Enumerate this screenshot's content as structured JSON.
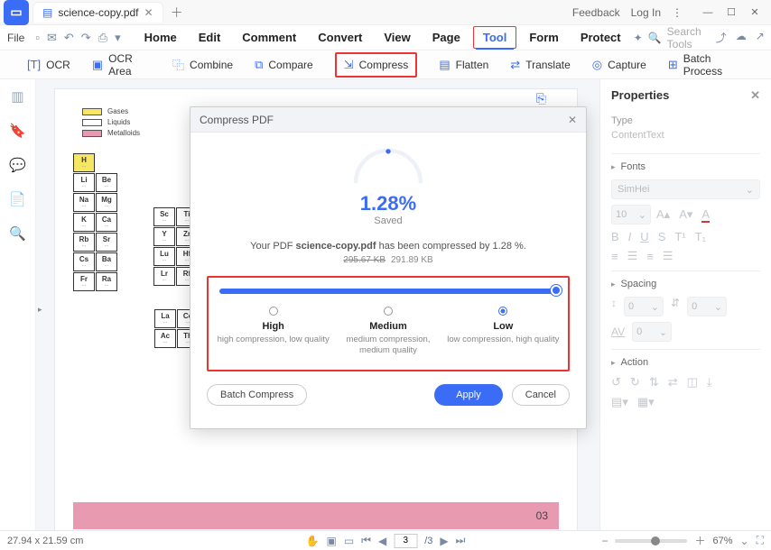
{
  "titlebar": {
    "filename": "science-copy.pdf",
    "feedback": "Feedback",
    "login": "Log In"
  },
  "menubar": {
    "file": "File",
    "items": [
      "Home",
      "Edit",
      "Comment",
      "Convert",
      "View",
      "Page",
      "Tool",
      "Form",
      "Protect"
    ],
    "active_index": 6,
    "search_placeholder": "Search Tools"
  },
  "ribbon": {
    "items": [
      "OCR",
      "OCR Area",
      "Combine",
      "Compare",
      "Compress",
      "Flatten",
      "Translate",
      "Capture",
      "Batch Process"
    ],
    "highlight_index": 4
  },
  "doc": {
    "legend": [
      {
        "color": "#f5e663",
        "label": "Gases"
      },
      {
        "color": "#ffffff",
        "label": "Liquids"
      },
      {
        "color": "#e89bb0",
        "label": "Metalloids"
      }
    ],
    "leftTable": [
      [
        {
          "sym": "H",
          "h": true
        }
      ],
      [
        {
          "sym": "Li"
        },
        {
          "sym": "Be"
        }
      ],
      [
        {
          "sym": "Na"
        },
        {
          "sym": "Mg"
        }
      ],
      [
        {
          "sym": "K"
        },
        {
          "sym": "Ca"
        }
      ],
      [
        {
          "sym": "Rb"
        },
        {
          "sym": "Sr"
        }
      ],
      [
        {
          "sym": "Cs"
        },
        {
          "sym": "Ba"
        }
      ],
      [
        {
          "sym": "Fr"
        },
        {
          "sym": "Ra"
        }
      ]
    ],
    "rightTable": [
      [
        {
          "sym": "Sc"
        },
        {
          "sym": "Ti"
        }
      ],
      [
        {
          "sym": "Y"
        },
        {
          "sym": "Zr"
        }
      ],
      [
        {
          "sym": "Lu"
        },
        {
          "sym": "Hf"
        }
      ],
      [
        {
          "sym": "Lr"
        },
        {
          "sym": "Rf"
        }
      ]
    ],
    "lowerTable": [
      [
        {
          "sym": "La"
        },
        {
          "sym": "Ce"
        }
      ],
      [
        {
          "sym": "Ac"
        },
        {
          "sym": "Th"
        }
      ]
    ],
    "page_number": "03"
  },
  "dialog": {
    "title": "Compress PDF",
    "percent": "1.28%",
    "saved_label": "Saved",
    "result_prefix": "Your PDF ",
    "result_filename": "science-copy.pdf",
    "result_mid": "  has been compressed by  ",
    "result_pct": "1.28 %.",
    "size_before": "295.67 KB",
    "size_after": "291.89 KB",
    "levels": [
      {
        "name": "High",
        "desc": "high compression, low quality"
      },
      {
        "name": "Medium",
        "desc": "medium compression, medium quality"
      },
      {
        "name": "Low",
        "desc": "low compression, high quality"
      }
    ],
    "selected_level": 2,
    "batch_label": "Batch Compress",
    "apply_label": "Apply",
    "cancel_label": "Cancel"
  },
  "properties": {
    "title": "Properties",
    "type_label": "Type",
    "type_value": "ContentText",
    "fonts_label": "Fonts",
    "font_value": "SimHei",
    "size_value": "10",
    "spacing_label": "Spacing",
    "spacing1": "0",
    "spacing2": "0",
    "spacing3": "0",
    "action_label": "Action"
  },
  "statusbar": {
    "dim": "27.94 x 21.59 cm",
    "page_current": "3",
    "page_total": "/3",
    "zoom": "67%"
  }
}
